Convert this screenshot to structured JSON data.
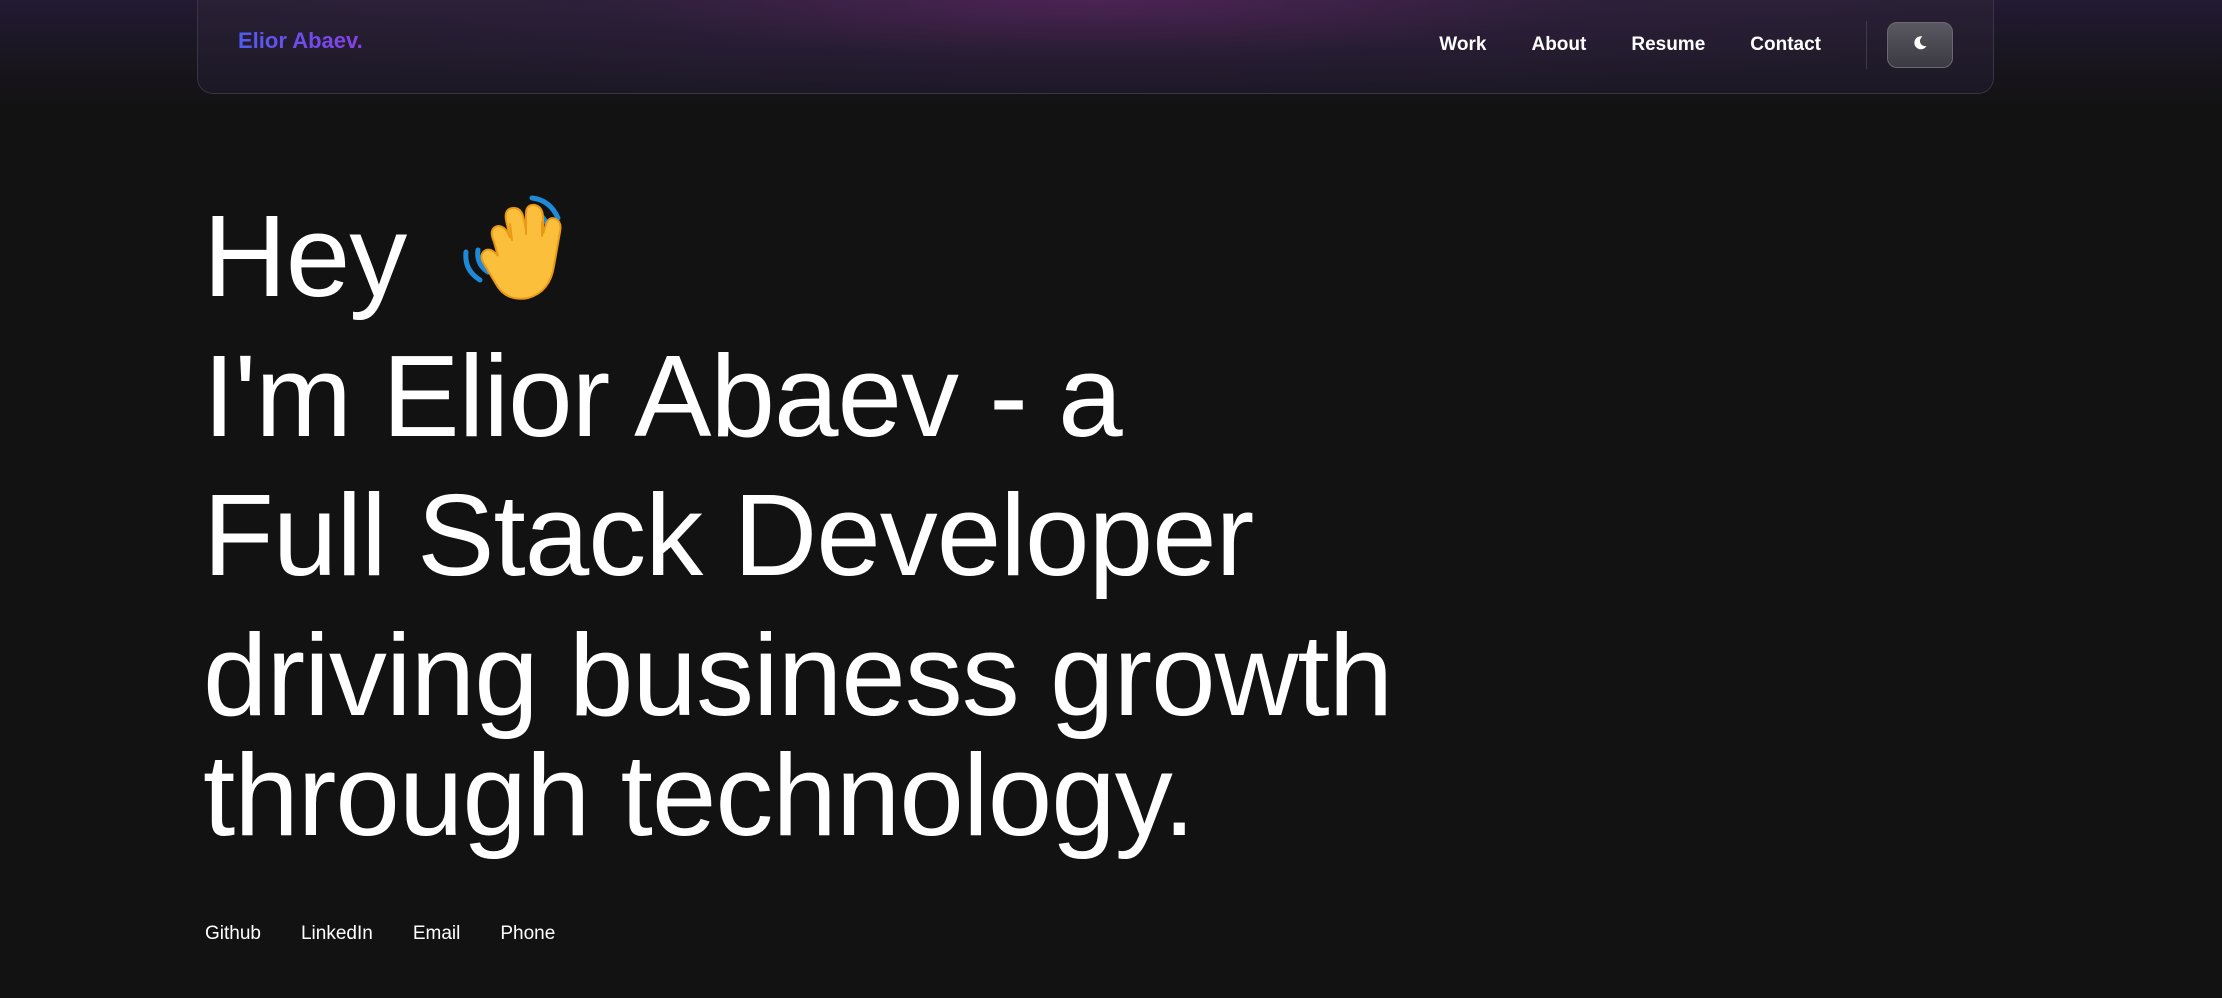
{
  "nav": {
    "logo": "Elior Abaev.",
    "links": [
      "Work",
      "About",
      "Resume",
      "Contact"
    ],
    "theme_toggle_icon": "moon-icon"
  },
  "hero": {
    "greeting": "Hey",
    "wave_icon": "waving-hand-icon",
    "lines": [
      "I'm Elior Abaev - a",
      "Full Stack Developer",
      "driving business growth",
      "through technology."
    ]
  },
  "social": {
    "links": [
      "Github",
      "LinkedIn",
      "Email",
      "Phone"
    ]
  },
  "colors": {
    "background": "#121212",
    "logo_gradient_start": "#4f5cf0",
    "logo_gradient_end": "#8b3fe6",
    "text": "#ffffff"
  }
}
